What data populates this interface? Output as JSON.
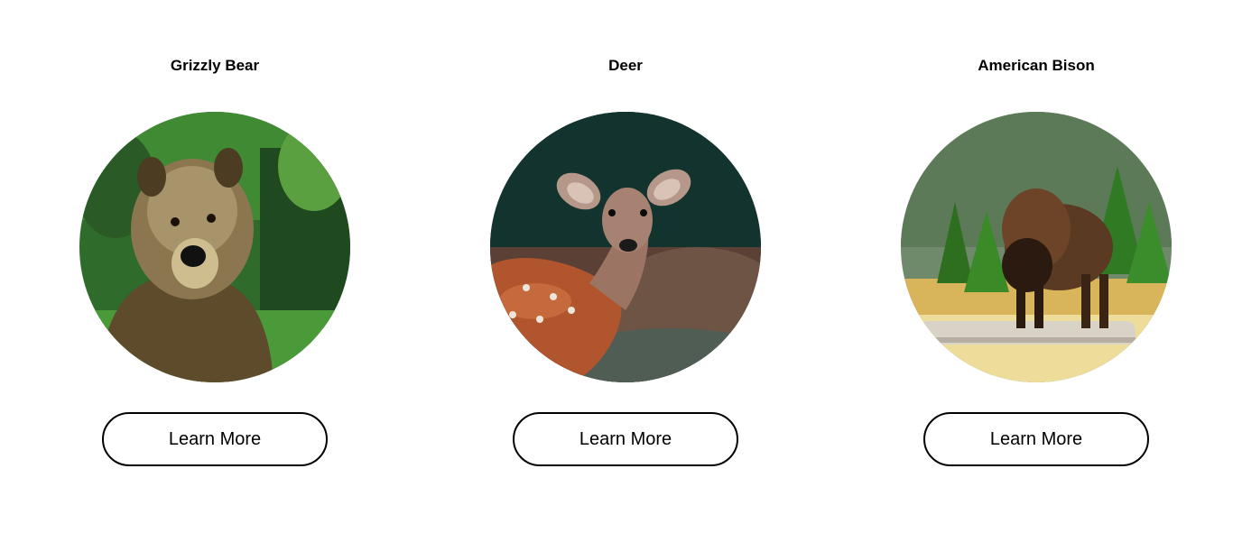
{
  "animals": [
    {
      "title": "Grizzly Bear",
      "image": "grizzly-bear-photo",
      "button_label": "Learn More"
    },
    {
      "title": "Deer",
      "image": "deer-photo",
      "button_label": "Learn More"
    },
    {
      "title": "American Bison",
      "image": "american-bison-photo",
      "button_label": "Learn More"
    }
  ]
}
